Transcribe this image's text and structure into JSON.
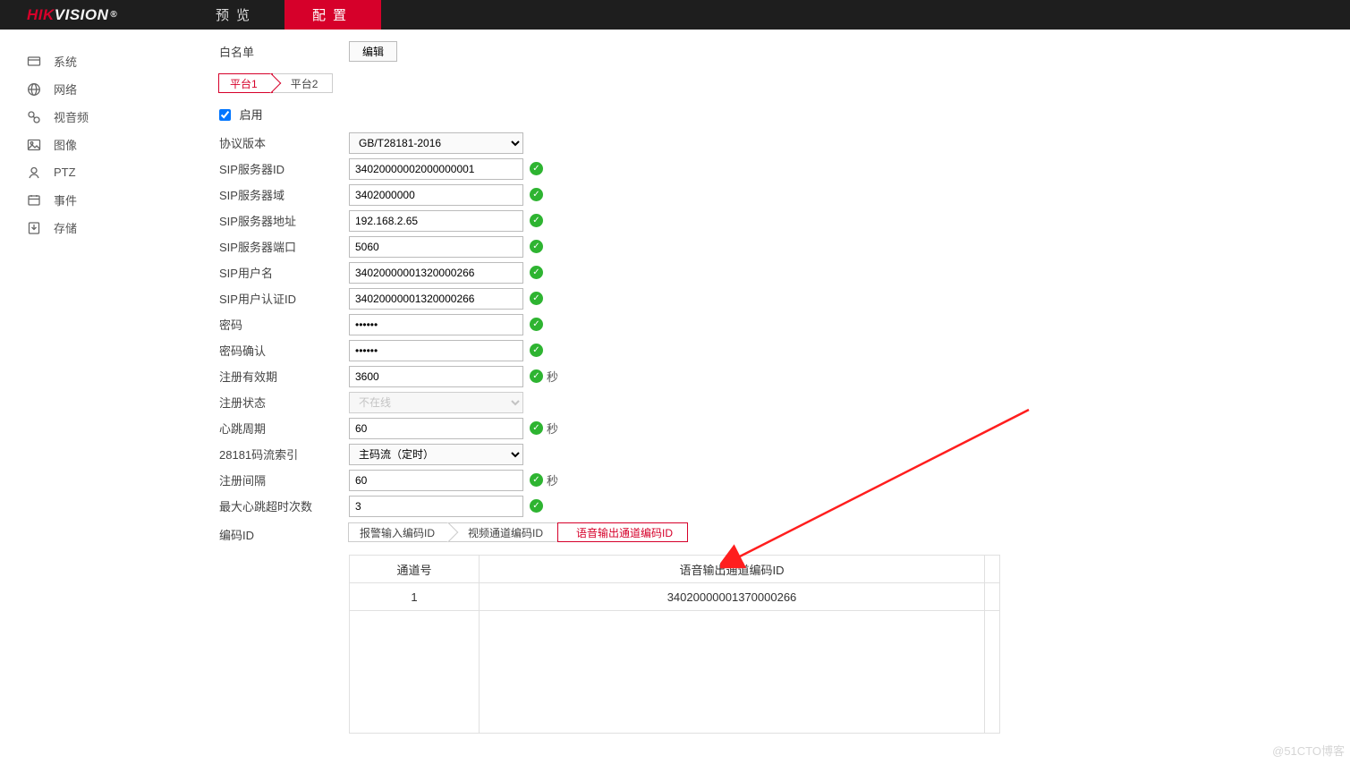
{
  "brand": {
    "part1": "HIK",
    "part2": "VISION",
    "reg": "®"
  },
  "topTabs": {
    "preview": "预览",
    "config": "配置"
  },
  "sidebar": {
    "items": [
      {
        "label": "系统"
      },
      {
        "label": "网络"
      },
      {
        "label": "视音频"
      },
      {
        "label": "图像"
      },
      {
        "label": "PTZ"
      },
      {
        "label": "事件"
      },
      {
        "label": "存储"
      }
    ]
  },
  "whitelist": {
    "label": "白名单",
    "button": "编辑"
  },
  "platformTabs": {
    "p1": "平台1",
    "p2": "平台2"
  },
  "enable_label": "启用",
  "fields": {
    "protocol": {
      "label": "协议版本",
      "value": "GB/T28181-2016"
    },
    "sip_server_id": {
      "label": "SIP服务器ID",
      "value": "34020000002000000001"
    },
    "sip_domain": {
      "label": "SIP服务器域",
      "value": "3402000000"
    },
    "sip_addr": {
      "label": "SIP服务器地址",
      "value": "192.168.2.65"
    },
    "sip_port": {
      "label": "SIP服务器端口",
      "value": "5060"
    },
    "sip_user": {
      "label": "SIP用户名",
      "value": "34020000001320000266"
    },
    "sip_auth_id": {
      "label": "SIP用户认证ID",
      "value": "34020000001320000266"
    },
    "password": {
      "label": "密码",
      "value": "••••••"
    },
    "password2": {
      "label": "密码确认",
      "value": "••••••"
    },
    "reg_valid": {
      "label": "注册有效期",
      "value": "3600",
      "suffix": "秒"
    },
    "reg_status": {
      "label": "注册状态",
      "value": "不在线"
    },
    "heartbeat": {
      "label": "心跳周期",
      "value": "60",
      "suffix": "秒"
    },
    "stream_idx": {
      "label": "28181码流索引",
      "value": "主码流（定时）"
    },
    "reg_interval": {
      "label": "注册间隔",
      "value": "60",
      "suffix": "秒"
    },
    "max_hb_to": {
      "label": "最大心跳超时次数",
      "value": "3"
    },
    "encode_id": {
      "label": "编码ID"
    }
  },
  "encodeTabs": {
    "alarm_in": "报警输入编码ID",
    "video_ch": "视频通道编码ID",
    "voice_out": "语音输出通道编码ID"
  },
  "grid": {
    "col1": "通道号",
    "col2": "语音输出通道编码ID",
    "rows": [
      {
        "ch": "1",
        "id": "34020000001370000266"
      }
    ]
  },
  "watermark": "@51CTO博客"
}
